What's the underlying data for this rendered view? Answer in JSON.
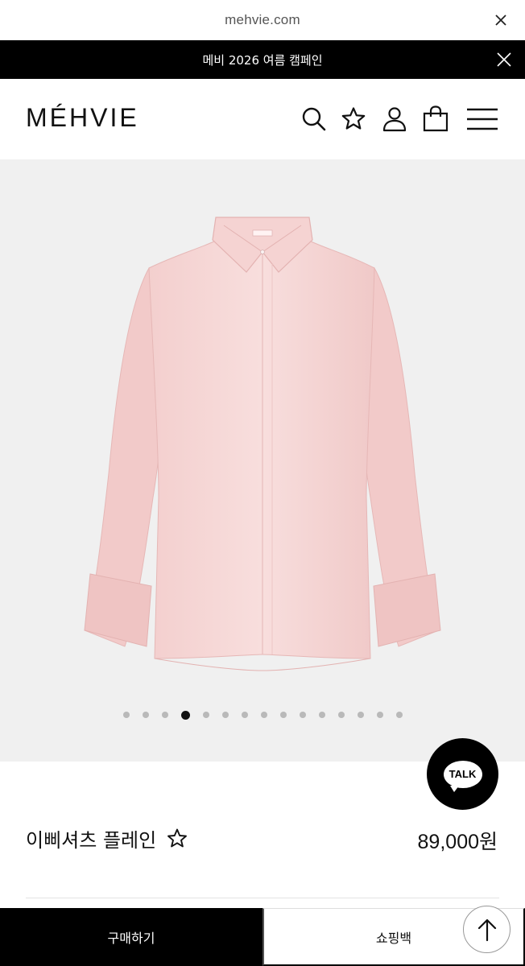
{
  "browser": {
    "url": "mehvie.com"
  },
  "promo": {
    "text": "메비 2026 여름 캠페인"
  },
  "header": {
    "logo": "MÉHVIE",
    "icons": [
      "search-icon",
      "star-icon",
      "user-icon",
      "shopping-bag-icon",
      "menu-icon"
    ]
  },
  "gallery": {
    "image": "pink-shirt-photo",
    "total_slides": 15,
    "active_slide": 4
  },
  "chat": {
    "label": "TALK"
  },
  "product": {
    "name": "이삐셔츠 플레인",
    "price": "89,000원"
  },
  "actions": {
    "buy_label": "구매하기",
    "bag_label": "쇼핑백"
  },
  "colors": {
    "accent": "#000000",
    "gallery_bg": "#f0f0f0",
    "shirt": "#f7d8d7"
  }
}
